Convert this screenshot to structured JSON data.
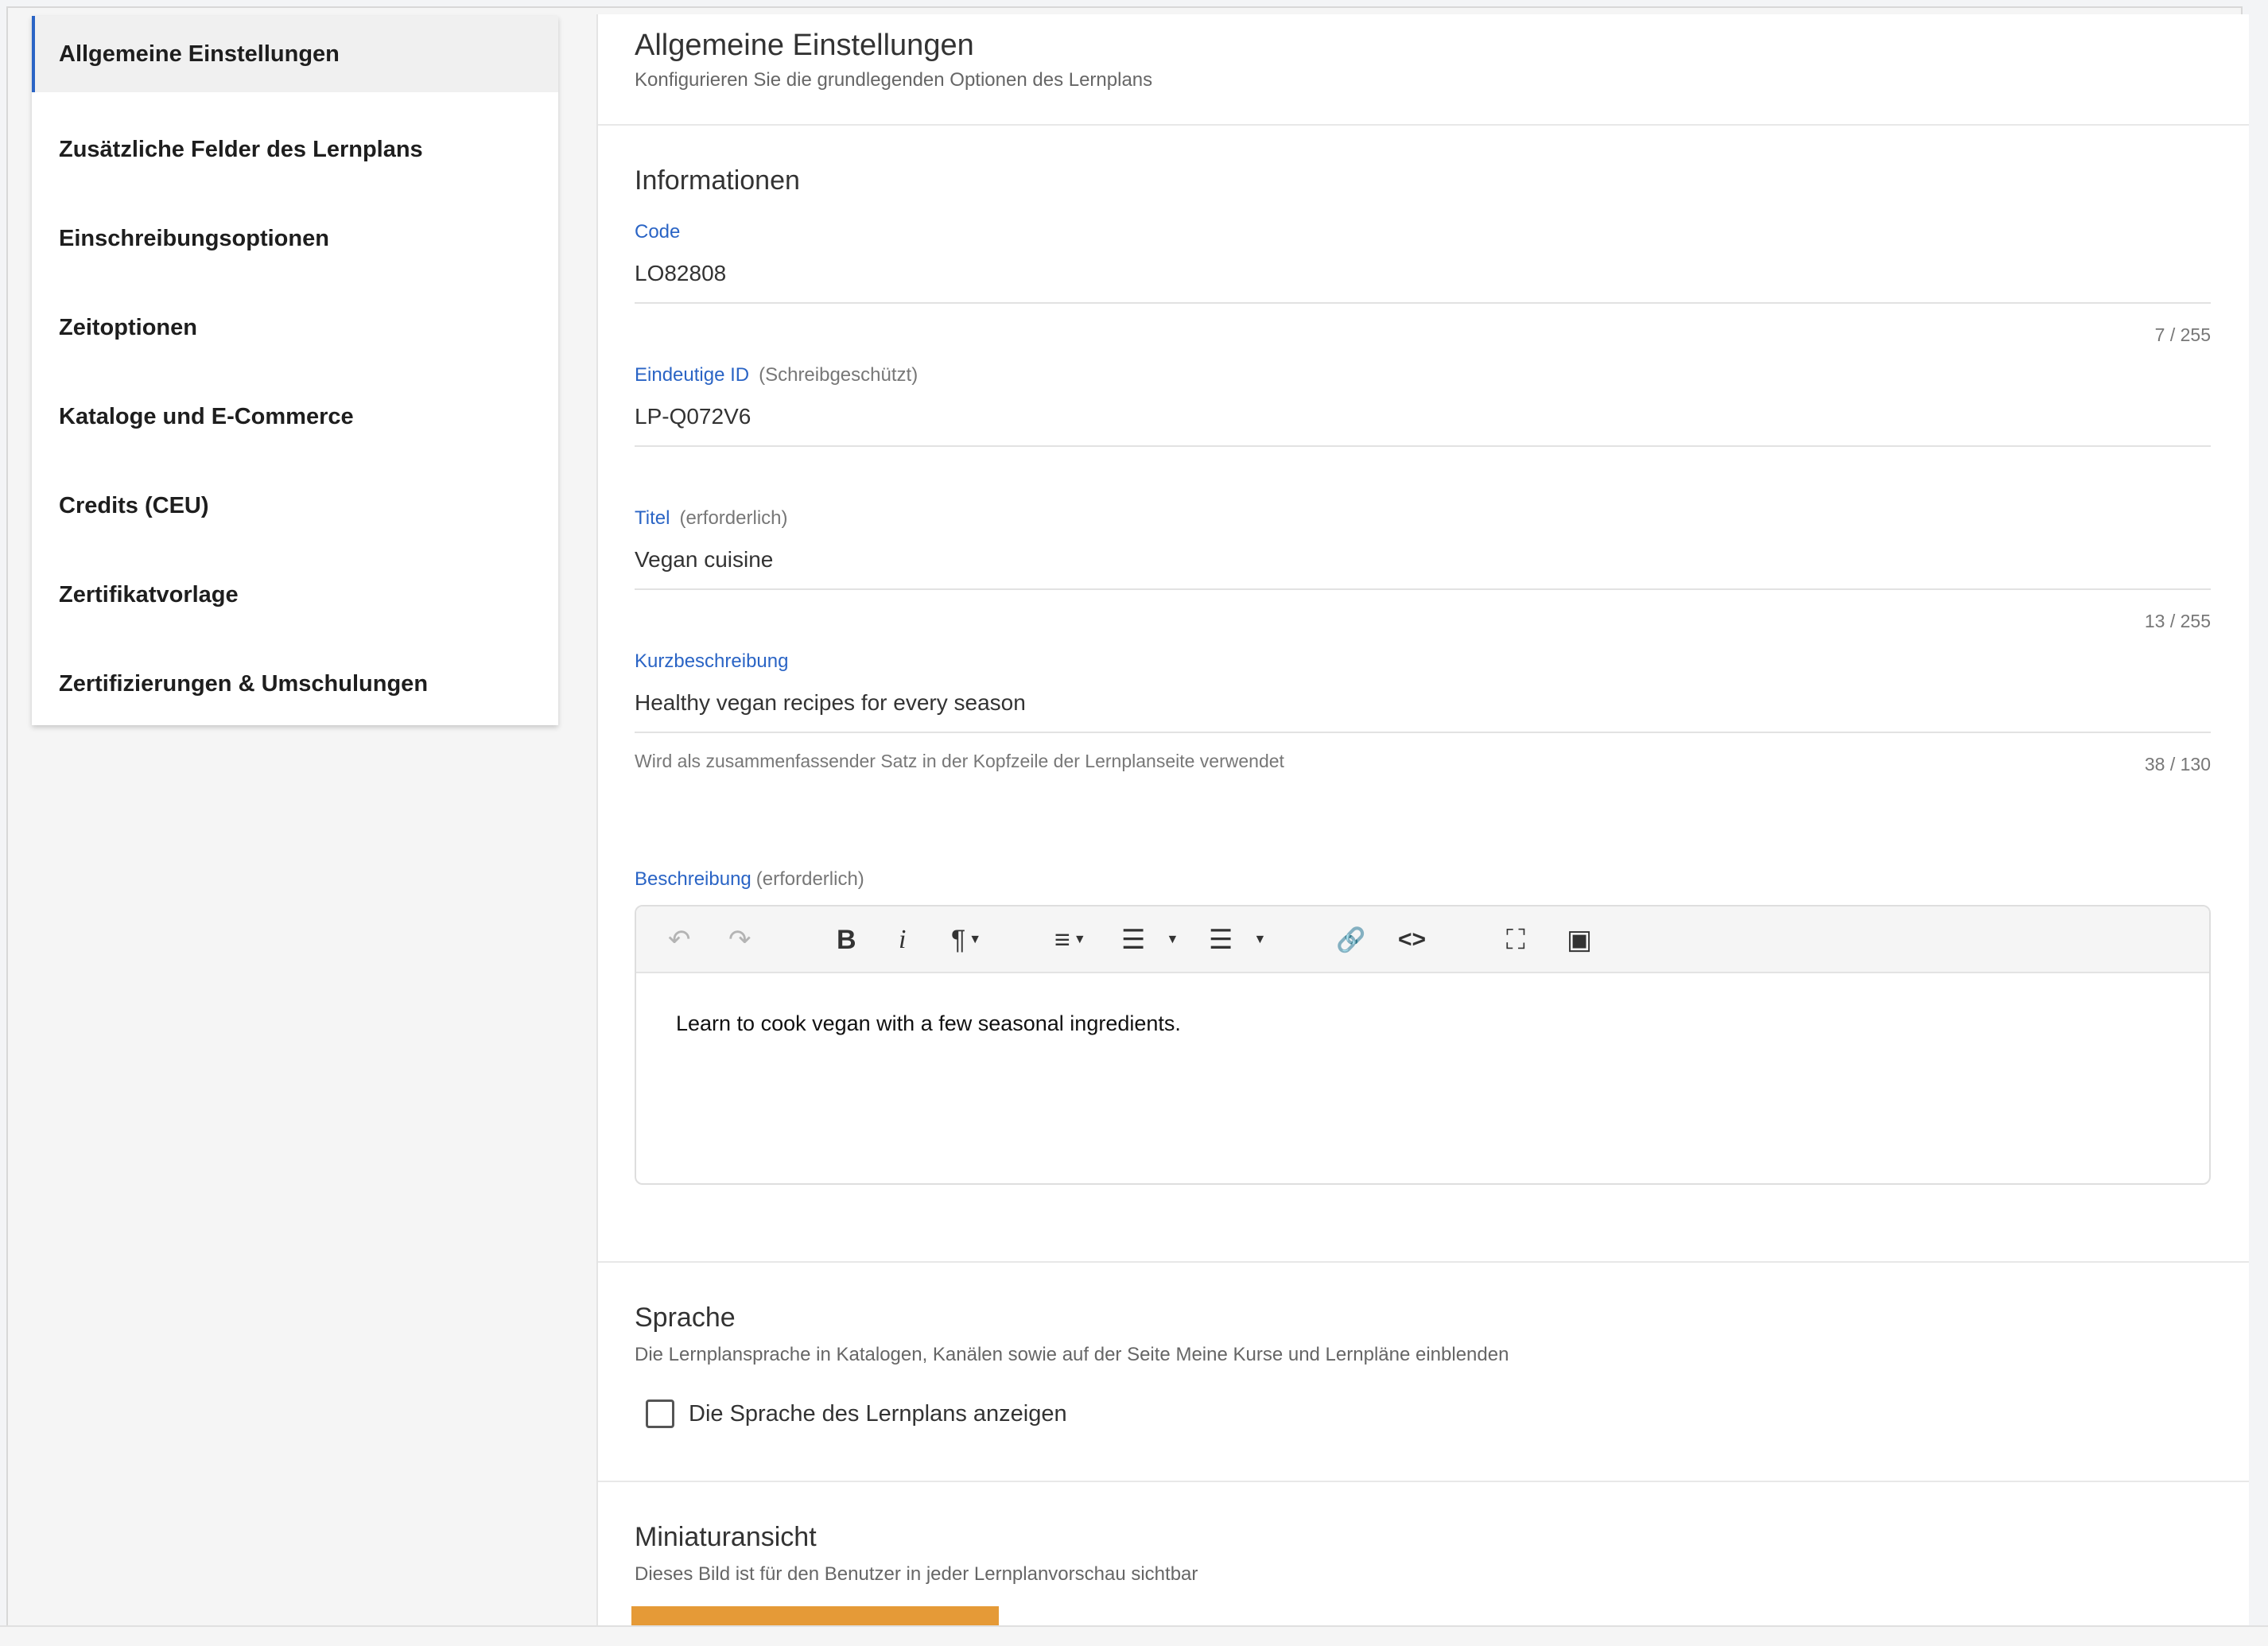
{
  "sidebar": {
    "items": [
      {
        "label": "Allgemeine Einstellungen",
        "active": true
      },
      {
        "label": "Zusätzliche Felder des Lernplans"
      },
      {
        "label": "Einschreibungsoptionen"
      },
      {
        "label": "Zeitoptionen"
      },
      {
        "label": "Kataloge und E-Commerce"
      },
      {
        "label": "Credits (CEU)"
      },
      {
        "label": "Zertifikatvorlage"
      },
      {
        "label": "Zertifizierungen & Umschulungen"
      }
    ]
  },
  "header": {
    "title": "Allgemeine Einstellungen",
    "subtitle": "Konfigurieren Sie die grundlegenden Optionen des Lernplans"
  },
  "info": {
    "title": "Informationen",
    "code": {
      "label": "Code",
      "value": "LO82808",
      "counter": "7 / 255"
    },
    "uid": {
      "label": "Eindeutige ID",
      "extra": "(Schreibgeschützt)",
      "value": "LP-Q072V6"
    },
    "titel": {
      "label": "Titel",
      "extra": "(erforderlich)",
      "value": "Vegan cuisine",
      "counter": "13 / 255"
    },
    "short": {
      "label": "Kurzbeschreibung",
      "value": "Healthy vegan recipes for every season",
      "hint": "Wird als zusammenfassender Satz in der Kopfzeile der Lernplanseite verwendet",
      "counter": "38 / 130"
    },
    "desc": {
      "label": "Beschreibung",
      "extra": "(erforderlich)",
      "body": "Learn to cook vegan with a few seasonal ingredients."
    }
  },
  "toolbar": {
    "undo": "↶",
    "redo": "↷",
    "bold": "B",
    "italic": "i",
    "paragraph": "¶",
    "align": "≡",
    "ordered": "☰",
    "bullets": "☰",
    "link": "🔗",
    "code": "<>",
    "fullscreen": "⛶",
    "image": "▣",
    "caret": "▼"
  },
  "language": {
    "title": "Sprache",
    "subtitle": "Die Lernplansprache in Katalogen, Kanälen sowie auf der Seite Meine Kurse und Lernpläne einblenden",
    "checkbox_label": "Die Sprache des Lernplans anzeigen"
  },
  "thumbnail": {
    "title": "Miniaturansicht",
    "subtitle": "Dieses Bild ist für den Benutzer in jeder Lernplanvorschau sichtbar"
  },
  "colors": {
    "accent": "#2a64c5",
    "button": "#e59a37"
  }
}
